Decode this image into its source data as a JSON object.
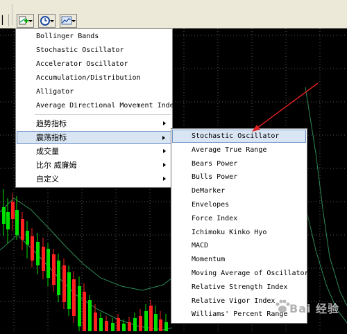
{
  "toolbar": {
    "buttons": [
      {
        "name": "indicators",
        "icon": "add-indicator-icon"
      },
      {
        "name": "periods",
        "icon": "clock-icon"
      },
      {
        "name": "templates",
        "icon": "chart-template-icon"
      }
    ]
  },
  "menu": {
    "recent_items": [
      {
        "label": "Bollinger Bands"
      },
      {
        "label": "Stochastic Oscillator"
      },
      {
        "label": "Accelerator Oscillator"
      },
      {
        "label": "Accumulation/Distribution"
      },
      {
        "label": "Alligator"
      },
      {
        "label": "Average Directional Movement Index"
      }
    ],
    "category_items": [
      {
        "label": "趋势指标"
      },
      {
        "label": "震荡指标"
      },
      {
        "label": "成交量"
      },
      {
        "label": "比尔 威廉姆"
      },
      {
        "label": "自定义"
      }
    ]
  },
  "submenu": {
    "items": [
      {
        "label": "Stochastic Oscillator"
      },
      {
        "label": "Average True Range"
      },
      {
        "label": "Bears Power"
      },
      {
        "label": "Bulls Power"
      },
      {
        "label": "DeMarker"
      },
      {
        "label": "Envelopes"
      },
      {
        "label": "Force Index"
      },
      {
        "label": "Ichimoku Kinko Hyo"
      },
      {
        "label": "MACD"
      },
      {
        "label": "Momentum"
      },
      {
        "label": "Moving Average of Oscillator"
      },
      {
        "label": "Relative Strength Index"
      },
      {
        "label": "Relative Vigor Index"
      },
      {
        "label": "Williams' Percent Range"
      }
    ]
  },
  "watermark": {
    "text": "Bai 经验"
  },
  "colors": {
    "chart_bg": "#000000",
    "grid": "#5a5a5a",
    "bull": "#00e000",
    "bear": "#ff2020",
    "envelope_line": "#2e8b57",
    "annotation_arrow": "#e02020",
    "menu_highlight": "#d9e5f3"
  }
}
